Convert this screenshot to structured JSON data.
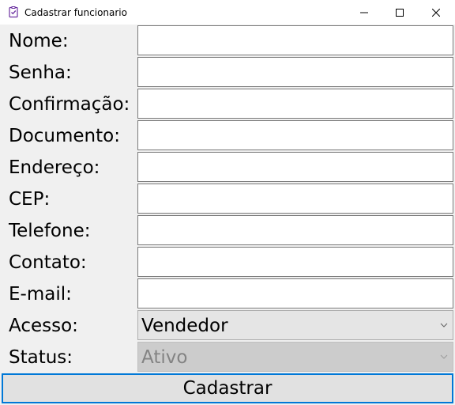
{
  "window": {
    "title": "Cadastrar funcionario",
    "icon": "clipboard-check-icon"
  },
  "titlebar_controls": [
    "minimize-icon",
    "maximize-icon",
    "close-icon"
  ],
  "form": {
    "fields": [
      {
        "label": "Nome:",
        "value": ""
      },
      {
        "label": "Senha:",
        "value": ""
      },
      {
        "label": "Confirmação:",
        "value": ""
      },
      {
        "label": "Documento:",
        "value": ""
      },
      {
        "label": "Endereço:",
        "value": ""
      },
      {
        "label": "CEP:",
        "value": ""
      },
      {
        "label": "Telefone:",
        "value": ""
      },
      {
        "label": "Contato:",
        "value": ""
      },
      {
        "label": "E-mail:",
        "value": ""
      }
    ],
    "acesso": {
      "label": "Acesso:",
      "selected": "Vendedor"
    },
    "status": {
      "label": "Status:",
      "selected": "Ativo",
      "enabled": false
    }
  },
  "submit_label": "Cadastrar",
  "colors": {
    "focus_border": "#0078d7",
    "window_bg": "#f0f0f0",
    "disabled_text": "#838383"
  }
}
